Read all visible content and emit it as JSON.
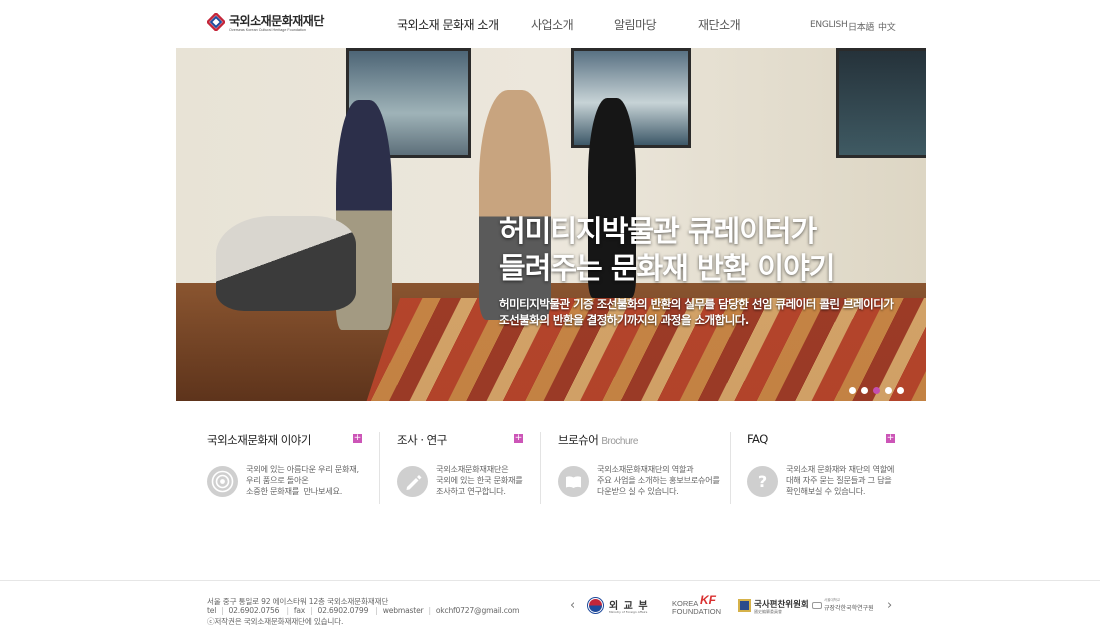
{
  "header": {
    "logo_kr": "국외소재문화재재단",
    "logo_en": "Overseas Korean Cultural Heritage Foundation",
    "nav": [
      "국외소재 문화재 소개",
      "사업소개",
      "알림마당",
      "재단소개"
    ],
    "langs": [
      "ENGLISH",
      "日本語",
      "中文"
    ]
  },
  "hero": {
    "title_line1": "허미티지박물관 큐레이터가",
    "title_line2": "들려주는 문화재 반환 이야기",
    "sub_line1": "허미티지박물관 기증 조선불화의 반환의 실무를 담당한 선임 큐레이터 콜린 브레이디가",
    "sub_line2": "조선불화의 반환을 결정하기까지의 과정을 소개합니다.",
    "slide_count": 5,
    "active_slide": 3
  },
  "features": [
    {
      "title": "국외소재문화재 이야기",
      "title_en": "",
      "icon": "target-icon",
      "desc": "국외에 있는 아름다운 우리 문화재,\n우리 품으로 돌아온\n소중한 문화재를  만나보세요."
    },
    {
      "title": "조사 · 연구",
      "title_en": "",
      "icon": "pencil-icon",
      "desc": "국외소재문화재재단은\n국외에 있는 한국 문화재를\n조사하고 연구합니다."
    },
    {
      "title": "브로슈어",
      "title_en": "Brochure",
      "icon": "book-icon",
      "desc": "국외소재문화재재단의 역할과\n주요 사업을 소개하는 홍보브로슈어를\n다운받으 실 수 있습니다."
    },
    {
      "title": "FAQ",
      "title_en": "",
      "icon": "question-icon",
      "desc": "국외소재 문화재와 재단의 역할에\n대해 자주 묻는 질문들과 그 답을\n확인해보실 수 있습니다."
    }
  ],
  "footer": {
    "address": "서울 중구 통일로 92 에이스타워 12층 국외소재문화재재단",
    "tel_label": "tel",
    "tel": "02.6902.0756",
    "fax_label": "fax",
    "fax": "02.6902.0799",
    "webmaster_label": "webmaster",
    "email": "okchf0727@gmail.com",
    "copyright": "ⓒ저작권은 국외소재문화재재단에 있습니다.",
    "partners": {
      "mofa": "외 교 부",
      "mofa_en": "Ministry of Foreign Affairs",
      "kf_top": "KOREA",
      "kf_mark": "KF",
      "kf_bottom": "FOUNDATION",
      "nihc": "국사편찬위원회",
      "nihc_sub": "國史編纂委員會",
      "kyujang": "규장각한국학연구원",
      "kyujang_sub": "서울대학교"
    }
  },
  "colors": {
    "accent": "#cc55b7",
    "nav_text": "#555555"
  }
}
